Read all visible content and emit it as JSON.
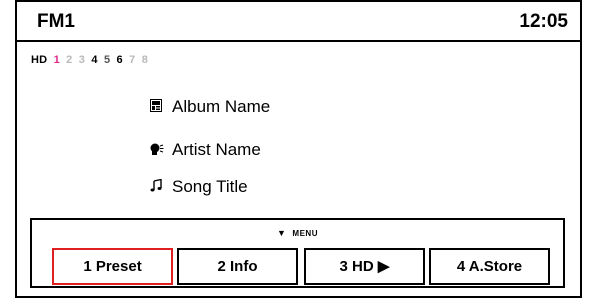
{
  "header": {
    "band": "FM1",
    "clock": "12:05"
  },
  "hd_channels": {
    "prefix": "HD",
    "channels": [
      {
        "label": "1",
        "color": "#e0288c"
      },
      {
        "label": "2",
        "color": "#b9b9b9"
      },
      {
        "label": "3",
        "color": "#b9b9b9"
      },
      {
        "label": "4",
        "color": "#000000"
      },
      {
        "label": "5",
        "color": "#555555"
      },
      {
        "label": "6",
        "color": "#000000"
      },
      {
        "label": "7",
        "color": "#b9b9b9"
      },
      {
        "label": "8",
        "color": "#b9b9b9"
      }
    ]
  },
  "metadata": {
    "album": {
      "icon": "album-icon",
      "text": "Album Name"
    },
    "artist": {
      "icon": "artist-icon",
      "text": "Artist Name"
    },
    "song": {
      "icon": "music-note-icon",
      "text": "Song Title"
    }
  },
  "menu": {
    "label": "MENU",
    "softkeys": [
      {
        "label": "1 Preset",
        "active": true
      },
      {
        "label": "2 Info",
        "active": false
      },
      {
        "label": "3 HD ▶",
        "active": false
      },
      {
        "label": "4 A.Store",
        "active": false
      }
    ]
  },
  "colors": {
    "active_border": "#e02020",
    "hd_active": "#e0288c",
    "hd_inactive": "#b9b9b9"
  }
}
